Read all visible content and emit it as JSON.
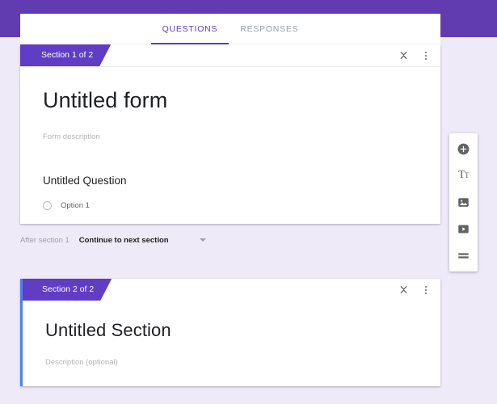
{
  "theme": {
    "header_purple": "#613cb0",
    "accent_purple": "#5f3dc4",
    "page_background": "#efeaf7",
    "card_background": "#ffffff",
    "selected_accent_blue": "#4f7ff0",
    "muted_text": "#9aa0a6",
    "placeholder_text": "#b5b5b5",
    "primary_text": "#202124"
  },
  "tabs": [
    {
      "label": "QUESTIONS",
      "active": true
    },
    {
      "label": "RESPONSES",
      "active": false
    }
  ],
  "section_one": {
    "tag_label": "Section 1 of 2",
    "collapse_icon": "collapse-icon",
    "more_icon": "more-vert-icon",
    "form_title": "Untitled form",
    "form_description_placeholder": "Form description",
    "question": {
      "title": "Untitled Question",
      "options": [
        {
          "label": "Option 1",
          "type": "radio",
          "selected": false
        }
      ]
    }
  },
  "after_section": {
    "label": "After section 1",
    "selected_value": "Continue to next section",
    "caret_icon": "chevron-down-icon"
  },
  "section_two": {
    "tag_label": "Section 2 of 2",
    "collapse_icon": "collapse-icon",
    "more_icon": "more-vert-icon",
    "title": "Untitled Section",
    "description_placeholder": "Description (optional)",
    "selected": true
  },
  "toolbar": {
    "items": [
      {
        "icon": "add-circle-icon",
        "name": "add-question"
      },
      {
        "icon": "title-text-icon",
        "name": "add-title-and-description",
        "glyph_large": "T",
        "glyph_small": "T"
      },
      {
        "icon": "image-icon",
        "name": "add-image"
      },
      {
        "icon": "video-icon",
        "name": "add-video"
      },
      {
        "icon": "section-icon",
        "name": "add-section"
      }
    ]
  }
}
